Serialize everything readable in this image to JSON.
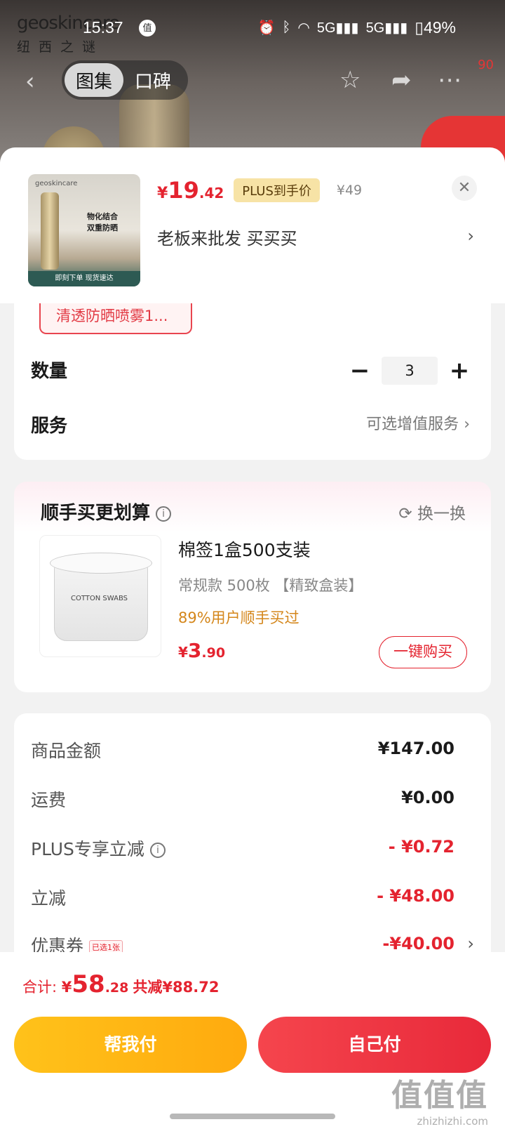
{
  "status_bar": {
    "time": "15:37",
    "zhi_badge": "值",
    "network1": "5G",
    "network2": "5G",
    "battery": "49%"
  },
  "background_page": {
    "brand_logo": "geoskincare",
    "brand_cn": "纽西之谜",
    "tabs": [
      {
        "label": "图集",
        "active": true
      },
      {
        "label": "口碑",
        "active": false
      }
    ],
    "msg_badge": "90"
  },
  "product": {
    "currency": "¥",
    "price_int": "19",
    "price_dec": ".42",
    "plus_tag": "PLUS到手价",
    "orig_price": "¥49",
    "spec_text": "老板来批发  买买买",
    "thumb": {
      "logo": "geoskincare",
      "line1": "物化结合",
      "line2": "双重防晒",
      "footer": "即刻下单  现货速达"
    }
  },
  "variant_chip": "清透防晒喷雾1...",
  "quantity": {
    "label": "数量",
    "minus": "−",
    "value": "3",
    "plus": "+"
  },
  "service": {
    "label": "服务",
    "value": "可选增值服务"
  },
  "addon": {
    "title": "顺手买更划算",
    "info": "i",
    "swap_label": "换一换",
    "item": {
      "name": "棉签1盒500支装",
      "spec": "常规款 500枚 【精致盒装】",
      "bought": "89%用户顺手买过",
      "currency": "¥",
      "price_int": "3",
      "price_dec": ".90",
      "buy_label": "一键购买",
      "img_label": "COTTON SWABS"
    }
  },
  "summary": {
    "rows": [
      {
        "key": "商品金额",
        "value": "¥147.00"
      },
      {
        "key": "运费",
        "value": "¥0.00"
      },
      {
        "key": "PLUS专享立减",
        "value": "- ¥0.72"
      },
      {
        "key": "立减",
        "value": "- ¥48.00"
      },
      {
        "key": "优惠券",
        "tag": "已选1张",
        "value": "-¥40.00"
      }
    ]
  },
  "footer": {
    "total_label": "合计:",
    "currency": "¥",
    "total_int": "58",
    "total_dec": ".28",
    "saved": "共减¥88.72",
    "help_pay": "帮我付",
    "self_pay": "自己付",
    "watermark_big": "值值值",
    "watermark_small": "zhizhizhi.com"
  },
  "colors": {
    "accent_red": "#e4232f",
    "help_yellow": "#ffb515",
    "plus_gold": "#f7e3a6"
  }
}
